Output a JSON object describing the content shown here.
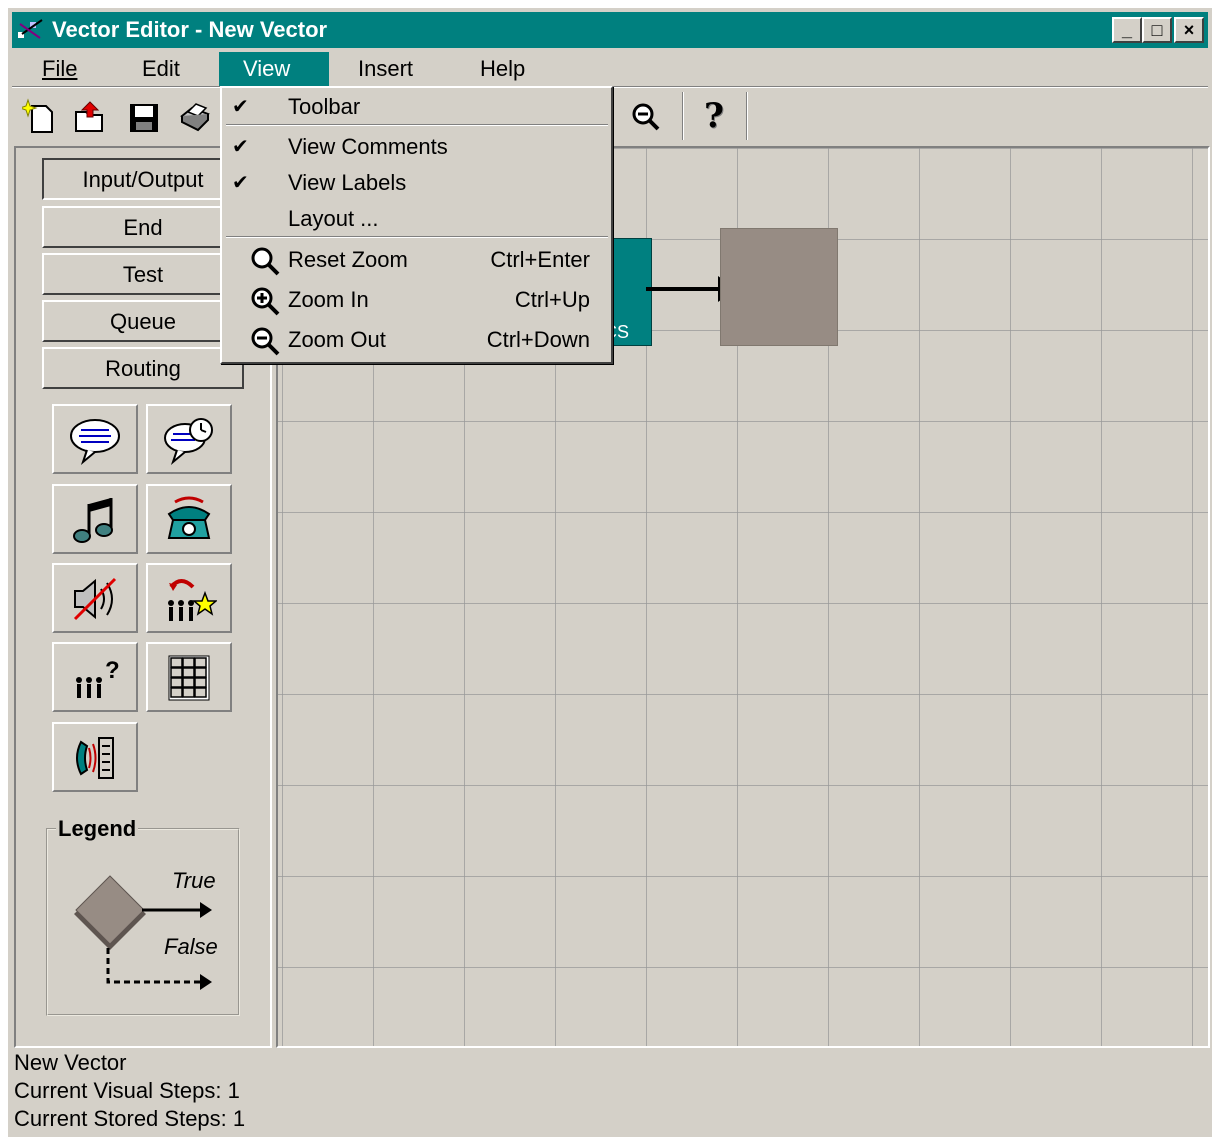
{
  "window": {
    "title": "Vector Editor - New Vector",
    "controls": {
      "minimize": "_",
      "maximize": "□",
      "close": "×"
    }
  },
  "menubar": {
    "items": [
      {
        "label": "File",
        "mnemonic": "F"
      },
      {
        "label": "Edit",
        "mnemonic": "E"
      },
      {
        "label": "View",
        "mnemonic": "V"
      },
      {
        "label": "Insert",
        "mnemonic": "I"
      },
      {
        "label": "Help",
        "mnemonic": "H"
      }
    ]
  },
  "view_menu": {
    "items": [
      {
        "label": "Toolbar",
        "checked": true
      },
      {
        "label": "View Comments",
        "checked": true
      },
      {
        "label": "View Labels",
        "checked": true
      },
      {
        "label": "Layout ...",
        "checked": false
      },
      {
        "label": "Reset Zoom",
        "shortcut": "Ctrl+Enter",
        "icon": "magnifier-icon"
      },
      {
        "label": "Zoom In",
        "shortcut": "Ctrl+Up",
        "icon": "zoom-in-icon"
      },
      {
        "label": "Zoom Out",
        "shortcut": "Ctrl+Down",
        "icon": "zoom-out-icon"
      }
    ]
  },
  "toolbar": {
    "icons": [
      "new-icon",
      "open-icon",
      "save-icon",
      "print-icon",
      "zoom-out-icon",
      "help-icon"
    ],
    "help_glyph": "?"
  },
  "palette": {
    "categories": [
      "Input/Output",
      "End",
      "Test",
      "Queue",
      "Routing"
    ],
    "selected_category": "Input/Output",
    "tools": [
      "announcement-icon",
      "timed-announcement-icon",
      "music-icon",
      "phone-icon",
      "mute-icon",
      "agent-favorite-icon",
      "agents-question-icon",
      "keypad-icon",
      "phone-server-icon"
    ]
  },
  "legend": {
    "title": "Legend",
    "true_label": "True",
    "false_label": "False"
  },
  "canvas": {
    "node_partial_label": "CS",
    "colors": {
      "node": "#008080",
      "empty_node": "#978c84",
      "grid": "#999999"
    }
  },
  "status": {
    "vector_name": "New Vector",
    "visual_steps": "Current Visual Steps: 1",
    "stored_steps": "Current Stored Steps: 1"
  }
}
